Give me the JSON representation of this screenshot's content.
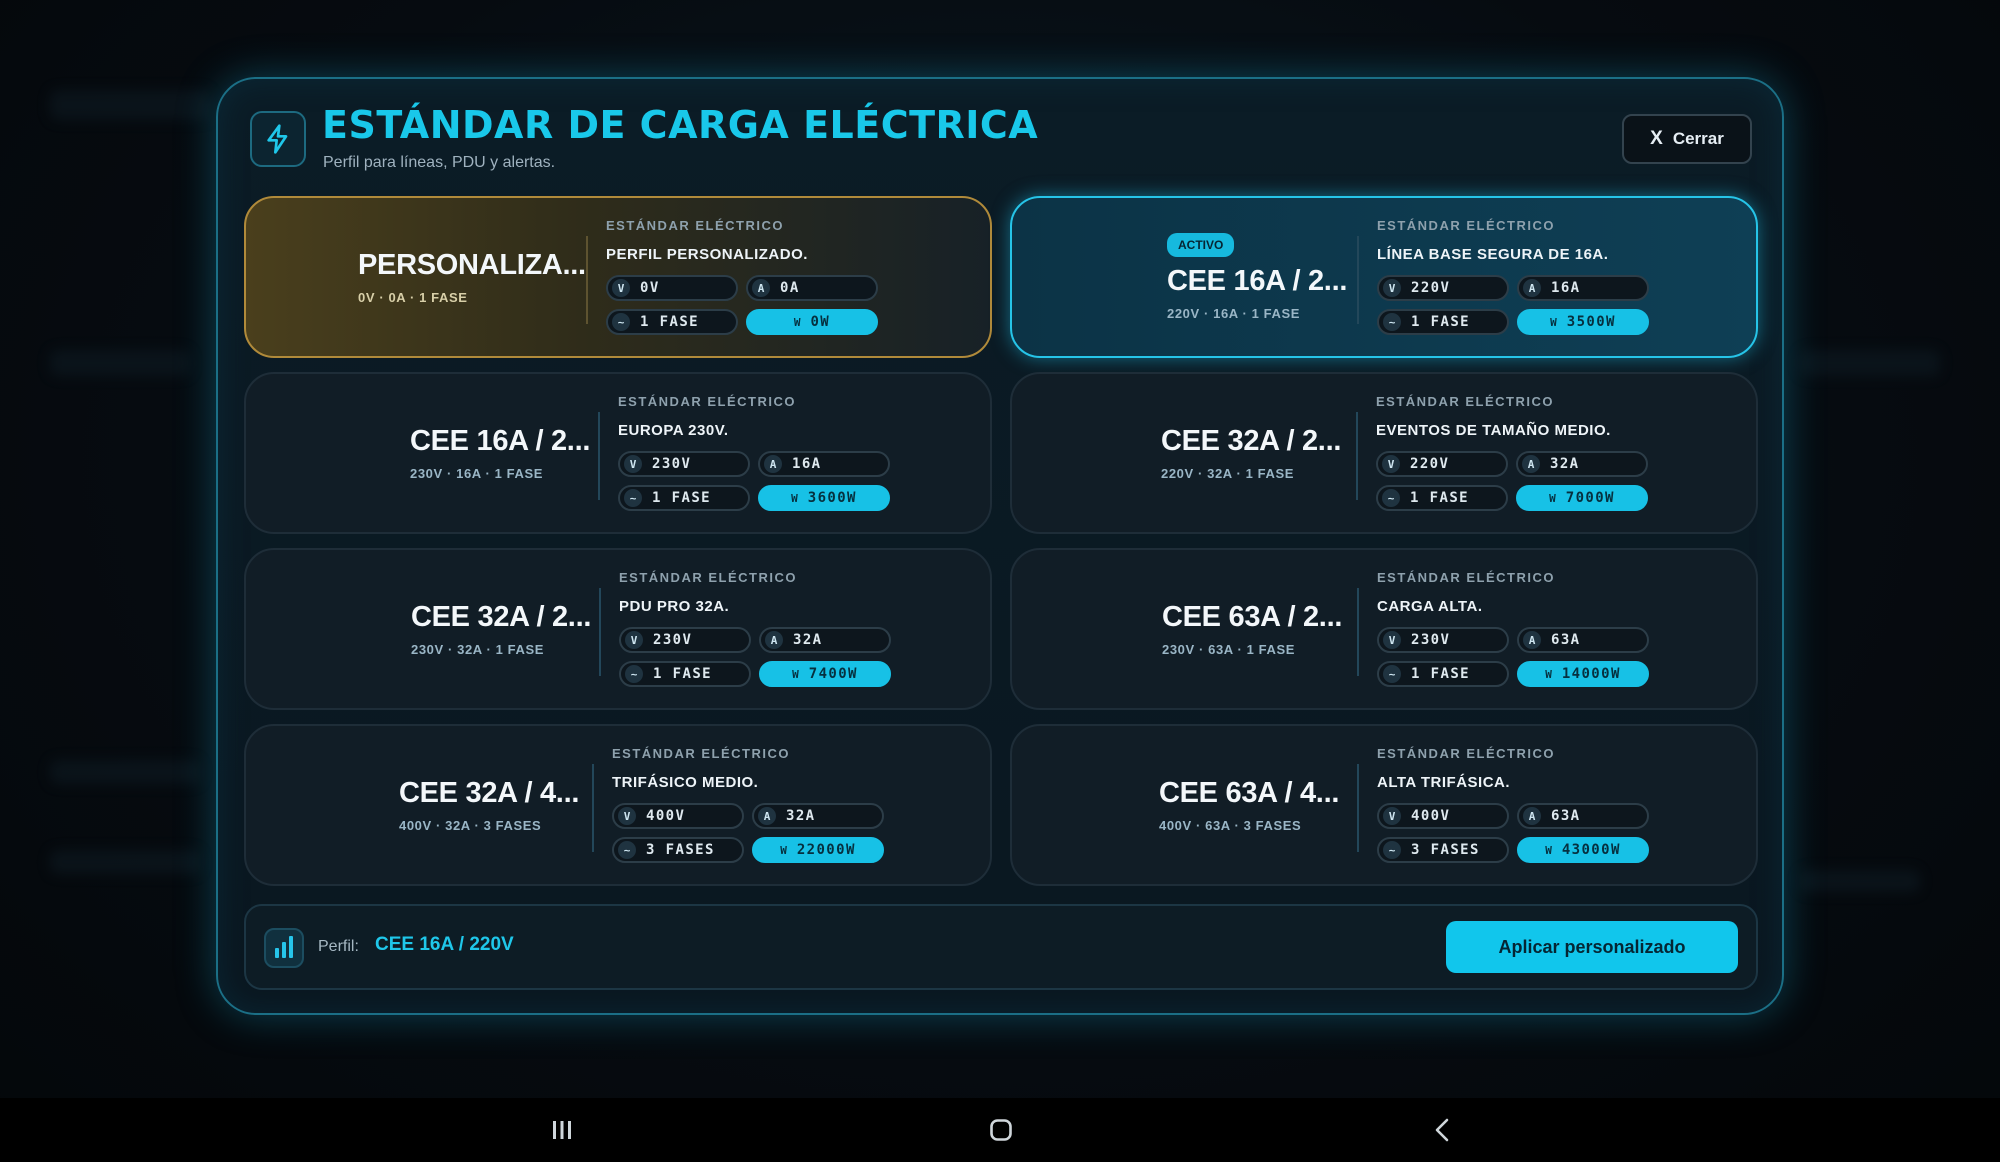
{
  "modal": {
    "title": "ESTÁNDAR DE CARGA ELÉCTRICA",
    "subtitle": "Perfil para líneas, PDU y alertas.",
    "close_label": "Cerrar",
    "close_glyph": "X"
  },
  "cards": [
    {
      "name": "PERSONALIZA...",
      "spec": "0V · 0A · 1 FASE",
      "kicker": "ESTÁNDAR ELÉCTRICO",
      "desc": "PERFIL PERSONALIZADO.",
      "v": "0V",
      "a": "0A",
      "phase": "1 FASE",
      "w": "0W"
    },
    {
      "badge": "ACTIVO",
      "name": "CEE 16A / 2...",
      "spec": "220V · 16A · 1 FASE",
      "kicker": "ESTÁNDAR ELÉCTRICO",
      "desc": "LÍNEA BASE SEGURA DE 16A.",
      "v": "220V",
      "a": "16A",
      "phase": "1 FASE",
      "w": "3500W"
    },
    {
      "name": "CEE 16A / 2...",
      "spec": "230V · 16A · 1 FASE",
      "kicker": "ESTÁNDAR ELÉCTRICO",
      "desc": "EUROPA 230V.",
      "v": "230V",
      "a": "16A",
      "phase": "1 FASE",
      "w": "3600W"
    },
    {
      "name": "CEE 32A / 2...",
      "spec": "220V · 32A · 1 FASE",
      "kicker": "ESTÁNDAR ELÉCTRICO",
      "desc": "EVENTOS DE TAMAÑO MEDIO.",
      "v": "220V",
      "a": "32A",
      "phase": "1 FASE",
      "w": "7000W"
    },
    {
      "name": "CEE 32A / 2...",
      "spec": "230V · 32A · 1 FASE",
      "kicker": "ESTÁNDAR ELÉCTRICO",
      "desc": "PDU PRO 32A.",
      "v": "230V",
      "a": "32A",
      "phase": "1 FASE",
      "w": "7400W"
    },
    {
      "name": "CEE 63A / 2...",
      "spec": "230V · 63A · 1 FASE",
      "kicker": "ESTÁNDAR ELÉCTRICO",
      "desc": "CARGA ALTA.",
      "v": "230V",
      "a": "63A",
      "phase": "1 FASE",
      "w": "14000W"
    },
    {
      "name": "CEE 32A / 4...",
      "spec": "400V · 32A · 3 FASES",
      "kicker": "ESTÁNDAR ELÉCTRICO",
      "desc": "TRIFÁSICO MEDIO.",
      "v": "400V",
      "a": "32A",
      "phase": "3 FASES",
      "w": "22000W"
    },
    {
      "name": "CEE 63A / 4...",
      "spec": "400V · 63A · 3 FASES",
      "kicker": "ESTÁNDAR ELÉCTRICO",
      "desc": "ALTA TRIFÁSICA.",
      "v": "400V",
      "a": "63A",
      "phase": "3 FASES",
      "w": "43000W"
    }
  ],
  "pill_icons": {
    "v": "V",
    "a": "A",
    "phase": "~",
    "w": "W"
  },
  "footer": {
    "label": "Perfil:",
    "value": "CEE 16A / 220V",
    "apply_label": "Aplicar personalizado"
  },
  "colors": {
    "accent": "#19c8ea",
    "custom_border": "#b08a3a",
    "active_border": "#26c4e8"
  },
  "icons": {
    "header": "lightning-icon",
    "footer": "bar-chart-icon",
    "nav": [
      "recent-apps-icon",
      "home-icon",
      "back-icon"
    ]
  }
}
